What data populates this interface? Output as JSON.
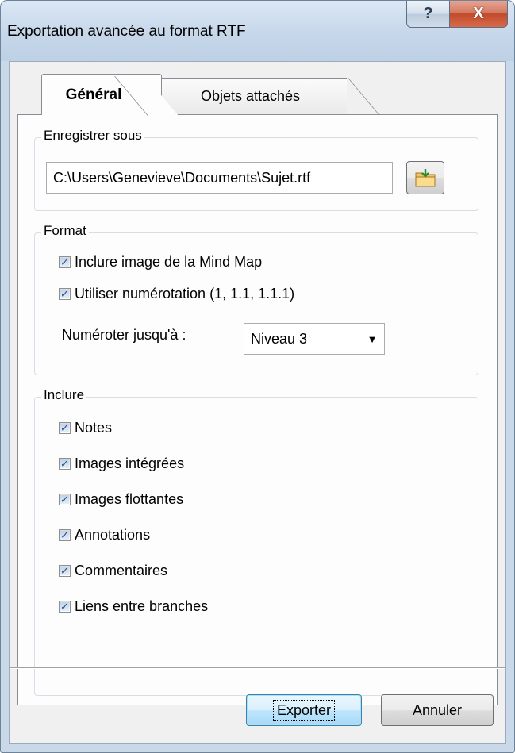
{
  "window": {
    "title": "Exportation avancée au format RTF",
    "help_glyph": "?",
    "close_glyph": "X"
  },
  "tabs": [
    {
      "label": "Général",
      "selected": true
    },
    {
      "label": "Objets attachés",
      "selected": false
    }
  ],
  "save_as": {
    "legend": "Enregistrer sous",
    "path_value": "C:\\Users\\Genevieve\\Documents\\Sujet.rtf",
    "browse_icon": "folder-export-icon"
  },
  "format": {
    "legend": "Format",
    "options": [
      {
        "label": "Inclure image de la Mind Map",
        "checked": true
      },
      {
        "label": "Utiliser numérotation (1, 1.1, 1.1.1)",
        "checked": true
      }
    ],
    "number_up_to_label": "Numéroter jusqu'à :",
    "number_up_to_value": "Niveau 3"
  },
  "include": {
    "legend": "Inclure",
    "options": [
      {
        "label": "Notes",
        "checked": true
      },
      {
        "label": "Images intégrées",
        "checked": true
      },
      {
        "label": "Images flottantes",
        "checked": true
      },
      {
        "label": "Annotations",
        "checked": true
      },
      {
        "label": "Commentaires",
        "checked": true
      },
      {
        "label": "Liens entre branches",
        "checked": true
      }
    ]
  },
  "buttons": {
    "export_label": "Exporter",
    "cancel_label": "Annuler"
  },
  "check_glyph": "✓",
  "dropdown_glyph": "▼"
}
